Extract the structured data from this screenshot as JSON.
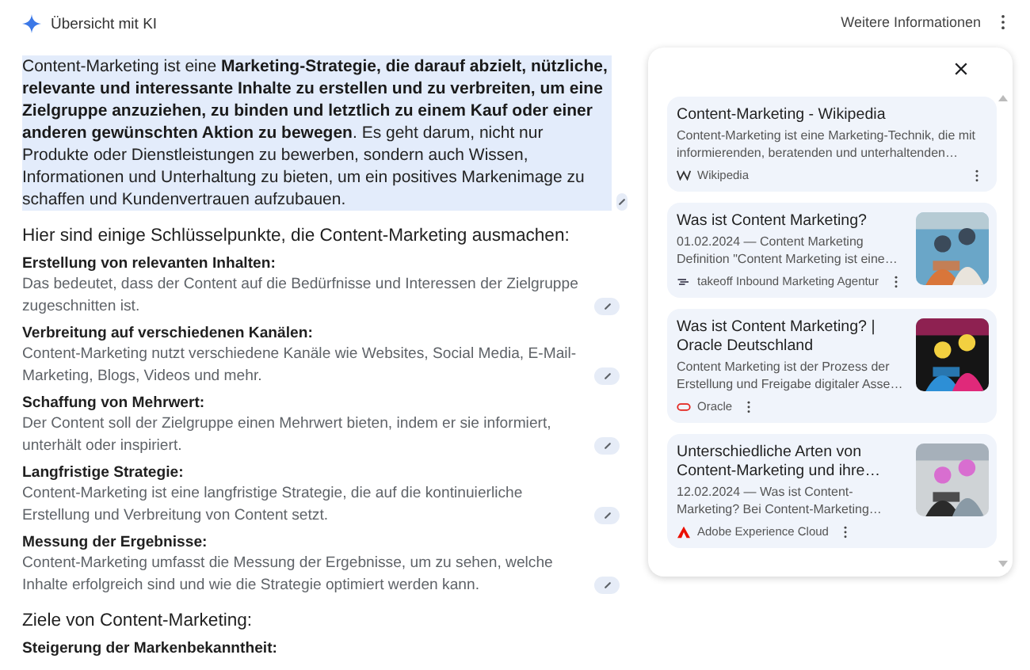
{
  "header": {
    "title": "Übersicht mit KI",
    "more_link": "Weitere Informationen"
  },
  "overview": {
    "intro": "Content-Marketing ist eine **Marketing-Strategie, die darauf abzielt, nützliche, relevante und interessante Inhalte zu erstellen und zu verbreiten, um eine Zielgruppe anzuziehen, zu binden und letztlich zu einem Kauf oder einer anderen gewünschten Aktion zu bewegen**. Es geht darum, nicht nur Produkte oder Dienstleistungen zu bewerben, sondern auch Wissen, Informationen und Unterhaltung zu bieten, um ein positives Markenimage zu schaffen und Kundenvertrauen aufzubauen.",
    "sections": [
      {
        "heading": "Hier sind einige Schlüsselpunkte, die Content-Marketing ausmachen:",
        "points": [
          {
            "title": "Erstellung von relevanten Inhalten:",
            "text": "Das bedeutet, dass der Content auf die Bedürfnisse und Interessen der Zielgruppe zugeschnitten ist."
          },
          {
            "title": "Verbreitung auf verschiedenen Kanälen:",
            "text": "Content-Marketing nutzt verschiedene Kanäle wie Websites, Social Media, E-Mail-Marketing, Blogs, Videos und mehr."
          },
          {
            "title": "Schaffung von Mehrwert:",
            "text": "Der Content soll der Zielgruppe einen Mehrwert bieten, indem er sie informiert, unterhält oder inspiriert."
          },
          {
            "title": "Langfristige Strategie:",
            "text": "Content-Marketing ist eine langfristige Strategie, die auf die kontinuierliche Erstellung und Verbreitung von Content setzt."
          },
          {
            "title": "Messung der Ergebnisse:",
            "text": "Content-Marketing umfasst die Messung der Ergebnisse, um zu sehen, welche Inhalte erfolgreich sind und wie die Strategie optimiert werden kann."
          }
        ]
      },
      {
        "heading": "Ziele von Content-Marketing:",
        "points": [
          {
            "title": "Steigerung der Markenbekanntheit:"
          }
        ]
      }
    ]
  },
  "sources": [
    {
      "title": "Content-Marketing - Wikipedia",
      "snippet": "Content-Marketing ist eine Marketing-Technik, die mit informierenden, beratenden und unterhaltenden…",
      "site": "Wikipedia",
      "kind": "wiki",
      "thumbnail": false
    },
    {
      "title": "Was ist Content Marketing?",
      "snippet": "01.02.2024 — Content Marketing Definition \"Content Marketing ist eine…",
      "site": "takeoff Inbound Marketing Agentur",
      "kind": "takeoff",
      "thumbnail": true
    },
    {
      "title": "Was ist Content Marketing? | Oracle Deutschland",
      "snippet": "Content Marketing ist der Prozess der Erstellung und Freigabe digitaler Asse…",
      "site": "Oracle",
      "kind": "oracle",
      "thumbnail": true
    },
    {
      "title": "Unterschiedliche Arten von Content-Marketing und ihre…",
      "snippet": "12.02.2024 — Was ist Content-Marketing? Bei Content-Marketing…",
      "site": "Adobe Experience Cloud",
      "kind": "adobe",
      "thumbnail": true
    }
  ]
}
